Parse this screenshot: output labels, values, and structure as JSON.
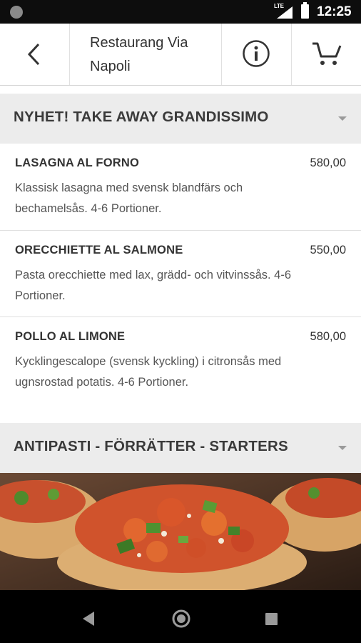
{
  "statusbar": {
    "time": "12:25",
    "network": "LTE"
  },
  "header": {
    "title": "Restaurang Via Napoli"
  },
  "icons": {
    "back": "back-arrow-icon",
    "info": "info-icon",
    "cart": "cart-icon"
  },
  "sections": [
    {
      "title": "NYHET! TAKE AWAY GRANDISSIMO",
      "items": [
        {
          "name": "LASAGNA AL FORNO",
          "price": "580,00",
          "description": "Klassisk lasagna med svensk blandfärs och bechamelsås. 4-6 Portioner."
        },
        {
          "name": "ORECCHIETTE AL SALMONE",
          "price": "550,00",
          "description": "Pasta orecchiette med lax, grädd- och vitvinssås. 4-6 Portioner."
        },
        {
          "name": "POLLO AL LIMONE",
          "price": "580,00",
          "description": "Kycklingescalope (svensk kyckling) i citronsås med ugnsrostad potatis. 4-6 Portioner."
        }
      ]
    },
    {
      "title": "ANTIPASTI - FÖRRÄTTER - STARTERS"
    }
  ],
  "colors": {
    "section_bg": "#ececec",
    "divider": "#e0e0e0"
  }
}
